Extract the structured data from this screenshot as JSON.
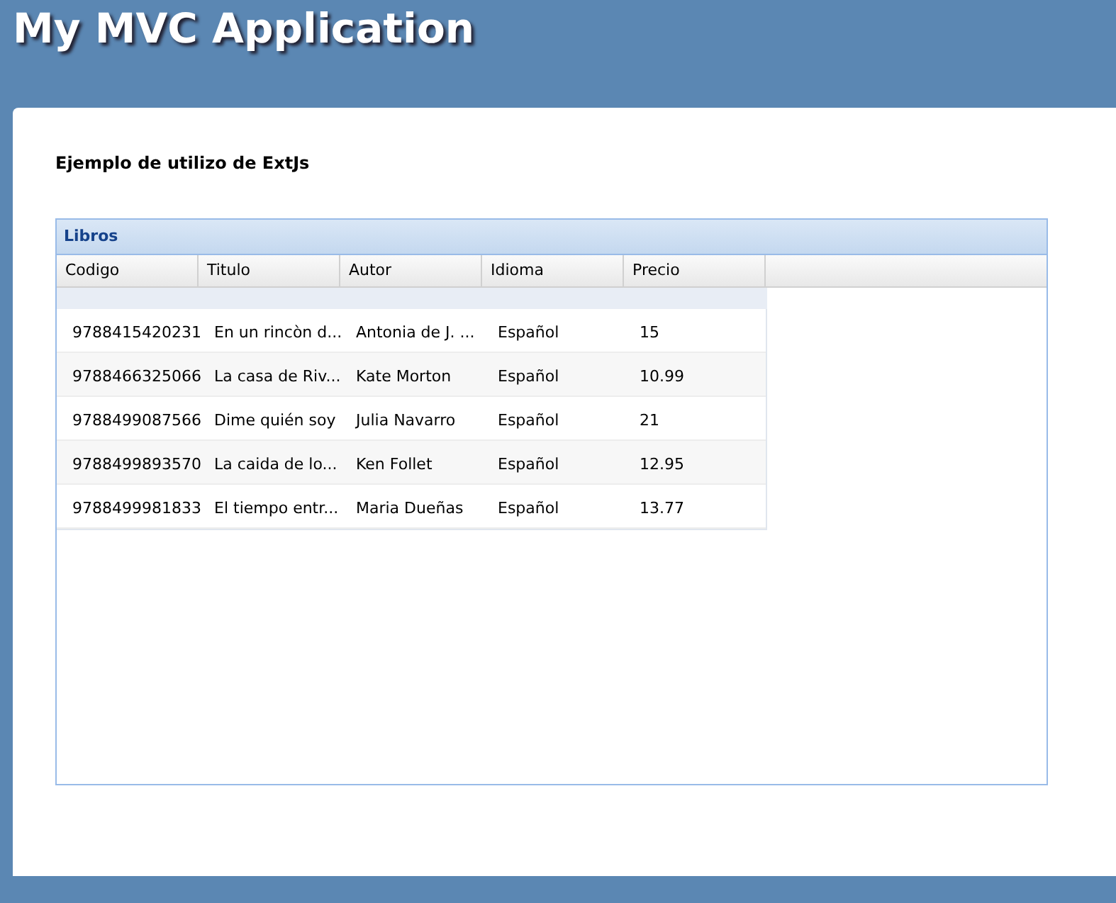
{
  "app_title": "My MVC Application",
  "heading": "Ejemplo de utilizo de ExtJs",
  "grid": {
    "title": "Libros",
    "columns": [
      "Codigo",
      "Titulo",
      "Autor",
      "Idioma",
      "Precio"
    ],
    "rows": [
      {
        "cells": [
          "9788415420231",
          "En un rincòn d...",
          "Antonia de J. ...",
          "Español",
          "15"
        ]
      },
      {
        "cells": [
          "9788466325066",
          "La casa de Riv...",
          "Kate Morton",
          "Español",
          "10.99"
        ]
      },
      {
        "cells": [
          "9788499087566",
          "Dime quién soy",
          "Julia Navarro",
          "Español",
          "21"
        ]
      },
      {
        "cells": [
          "9788499893570",
          "La caida de lo...",
          "Ken Follet",
          "Español",
          "12.95"
        ]
      },
      {
        "cells": [
          "9788499981833",
          "El tiempo entr...",
          "Maria Dueñas",
          "Español",
          "13.77"
        ]
      }
    ]
  }
}
